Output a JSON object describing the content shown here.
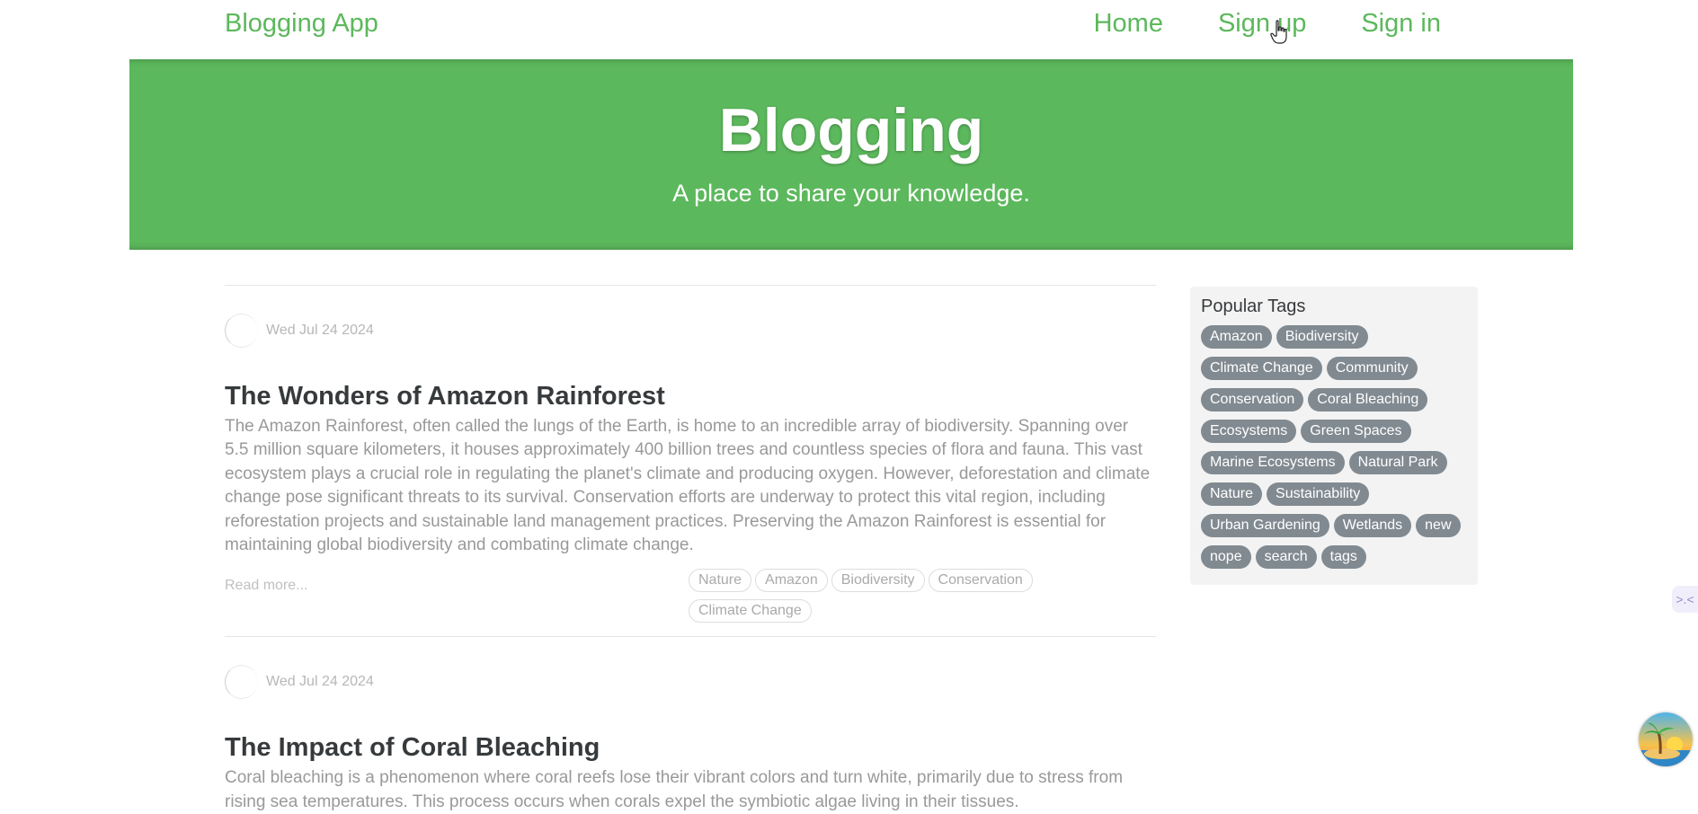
{
  "navbar": {
    "brand": "Blogging App",
    "links": [
      "Home",
      "Sign up",
      "Sign in"
    ],
    "accent_color": "#5cb85c"
  },
  "banner": {
    "title": "Blogging",
    "subtitle": "A place to share your knowledge."
  },
  "articles": [
    {
      "date": "Wed Jul 24 2024",
      "title": "The Wonders of Amazon Rainforest",
      "body": "The Amazon Rainforest, often called the lungs of the Earth, is home to an incredible array of biodiversity. Spanning over 5.5 million square kilometers, it houses approximately 400 billion trees and countless species of flora and fauna. This vast ecosystem plays a crucial role in regulating the planet's climate and producing oxygen. However, deforestation and climate change pose significant threats to its survival. Conservation efforts are underway to protect this vital region, including reforestation projects and sustainable land management practices. Preserving the Amazon Rainforest is essential for maintaining global biodiversity and combating climate change.",
      "read_more": "Read more...",
      "tags": [
        "Nature",
        "Amazon",
        "Biodiversity",
        "Conservation",
        "Climate Change"
      ]
    },
    {
      "date": "Wed Jul 24 2024",
      "title": "The Impact of Coral Bleaching",
      "body": "Coral bleaching is a phenomenon where coral reefs lose their vibrant colors and turn white, primarily due to stress from rising sea temperatures. This process occurs when corals expel the symbiotic algae living in their tissues."
    }
  ],
  "sidebar": {
    "title": "Popular Tags",
    "tags": [
      "Amazon",
      "Biodiversity",
      "Climate Change",
      "Community",
      "Conservation",
      "Coral Bleaching",
      "Ecosystems",
      "Green Spaces",
      "Marine Ecosystems",
      "Natural Park",
      "Nature",
      "Sustainability",
      "Urban Gardening",
      "Wetlands",
      "new",
      "nope",
      "search",
      "tags"
    ]
  },
  "side_widget": {
    "icon": "collapse-icon",
    "glyph": ">.<"
  },
  "corner_avatar": {
    "icon": "palm-island-avatar"
  }
}
